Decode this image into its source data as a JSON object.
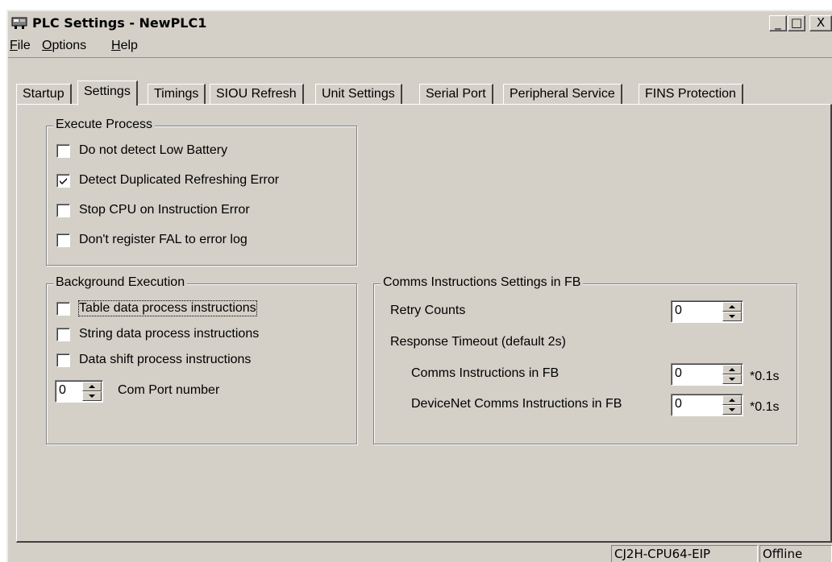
{
  "window": {
    "title": "PLC Settings - NewPLC1",
    "controls": {
      "minimize": "_",
      "maximize": "□",
      "close": "X"
    }
  },
  "menu": [
    {
      "label": "File",
      "mnemonic": "F",
      "rest": "ile"
    },
    {
      "label": "Options",
      "mnemonic": "O",
      "rest": "ptions"
    },
    {
      "label": "Help",
      "mnemonic": "H",
      "rest": "elp"
    }
  ],
  "tabs": [
    {
      "label": "Startup",
      "active": false
    },
    {
      "label": "Settings",
      "active": true
    },
    {
      "label": "Timings",
      "active": false
    },
    {
      "label": "SIOU Refresh",
      "active": false
    },
    {
      "label": "Unit Settings",
      "active": false
    },
    {
      "label": "Serial Port",
      "active": false
    },
    {
      "label": "Peripheral Service",
      "active": false
    },
    {
      "label": "FINS Protection",
      "active": false
    }
  ],
  "execute_process": {
    "title": "Execute Process",
    "options": [
      {
        "label": "Do not detect Low Battery",
        "checked": false
      },
      {
        "label": "Detect Duplicated Refreshing Error",
        "checked": true
      },
      {
        "label": "Stop CPU on Instruction Error",
        "checked": false
      },
      {
        "label": "Don't register FAL to error log",
        "checked": false
      }
    ]
  },
  "background_execution": {
    "title": "Background Execution",
    "options": [
      {
        "label": "Table data process instructions",
        "checked": false
      },
      {
        "label": "String data process instructions",
        "checked": false
      },
      {
        "label": "Data shift process instructions",
        "checked": false
      }
    ],
    "com_port": {
      "value": "0",
      "label": "Com Port number"
    }
  },
  "comms_fb": {
    "title": "Comms Instructions Settings in FB",
    "retry_counts": {
      "label": "Retry Counts",
      "value": "0"
    },
    "response_timeout_label": "Response Timeout (default 2s)",
    "comms_instructions": {
      "label": "Comms Instructions in FB",
      "value": "0",
      "unit": "*0.1s"
    },
    "devicenet_instructions": {
      "label": "DeviceNet Comms Instructions in FB",
      "value": "0",
      "unit": "*0.1s"
    }
  },
  "status": {
    "model": "CJ2H-CPU64-EIP",
    "mode": "Offline"
  }
}
